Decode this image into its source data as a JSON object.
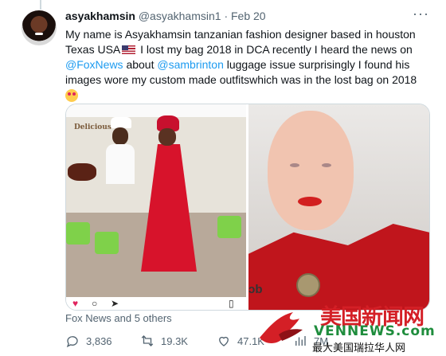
{
  "tweet": {
    "author_name": "asyakhamsin",
    "author_handle": "@asyakhamsin1",
    "separator": "·",
    "date": "Feb 20",
    "text_parts": {
      "p1": "My name is Asyakhamsin tanzanian fashion designer  based in houston Texas USA",
      "p2": " I lost my bag 2018 in DCA  recently I heard the news on ",
      "mention1": "@FoxNews",
      "p3": "  about ",
      "mention2": "@sambrinton",
      "p4": " luggage issue surprisingly I found his images wore my custom made outfitswhich  was in the lost bag on 2018"
    },
    "flag_icon": "us-flag-emoji",
    "emoji_icon": "star-struck-face-emoji"
  },
  "media": {
    "left_image": {
      "sign_text": "Delicious",
      "overlay_sign": "ↄb"
    },
    "instagram_icons": [
      "heart-icon",
      "comment-icon",
      "share-icon",
      "bookmark-icon"
    ]
  },
  "attribution": "Fox News and 5 others",
  "actions": {
    "replies": "3,836",
    "reposts": "19.3K",
    "likes": "47.1K",
    "views": "7M"
  },
  "watermark": {
    "title": "美国新闻网",
    "url": "VENNEWS.com",
    "subtitle": "最大美国瑞拉华人网"
  },
  "colors": {
    "link": "#1d9bf0",
    "secondary_text": "#536471",
    "liked_heart": "#e0245e",
    "watermark_red": "#d41f26",
    "watermark_green": "#1f8d3d"
  }
}
